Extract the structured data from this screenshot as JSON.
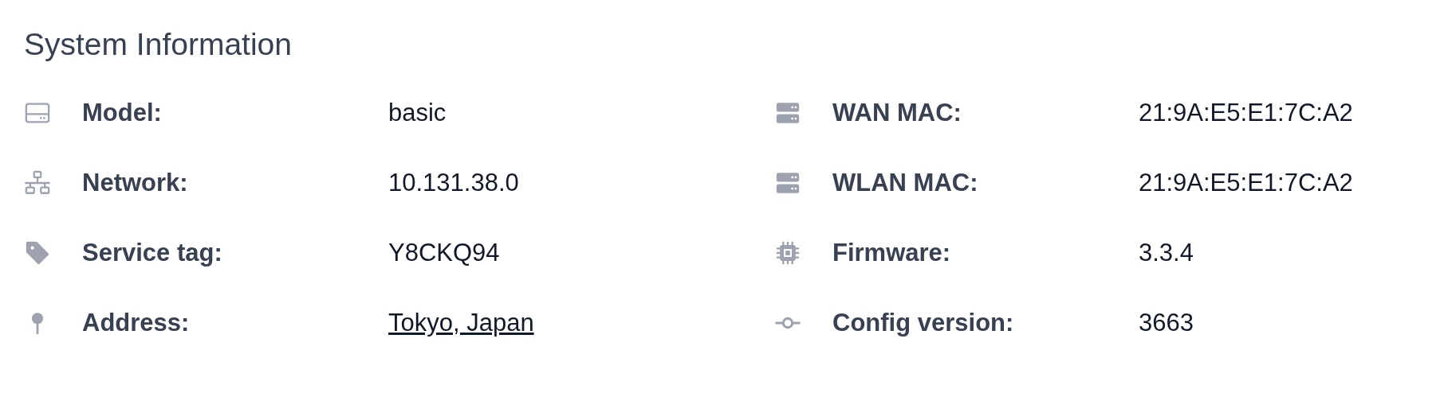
{
  "title": "System Information",
  "columns": [
    {
      "items": [
        {
          "kind": "drive",
          "label": "Model:",
          "value": "basic",
          "link": false
        },
        {
          "kind": "network",
          "label": "Network:",
          "value": "10.131.38.0",
          "link": false
        },
        {
          "kind": "tag",
          "label": "Service tag:",
          "value": "Y8CKQ94",
          "link": false
        },
        {
          "kind": "pin",
          "label": "Address:",
          "value": "Tokyo, Japan",
          "link": true
        }
      ]
    },
    {
      "items": [
        {
          "kind": "server",
          "label": "WAN MAC:",
          "value": "21:9A:E5:E1:7C:A2",
          "link": false
        },
        {
          "kind": "server",
          "label": "WLAN MAC:",
          "value": "21:9A:E5:E1:7C:A2",
          "link": false
        },
        {
          "kind": "chip",
          "label": "Firmware:",
          "value": "3.3.4",
          "link": false
        },
        {
          "kind": "commit",
          "label": "Config version:",
          "value": "3663",
          "link": false
        }
      ]
    }
  ]
}
